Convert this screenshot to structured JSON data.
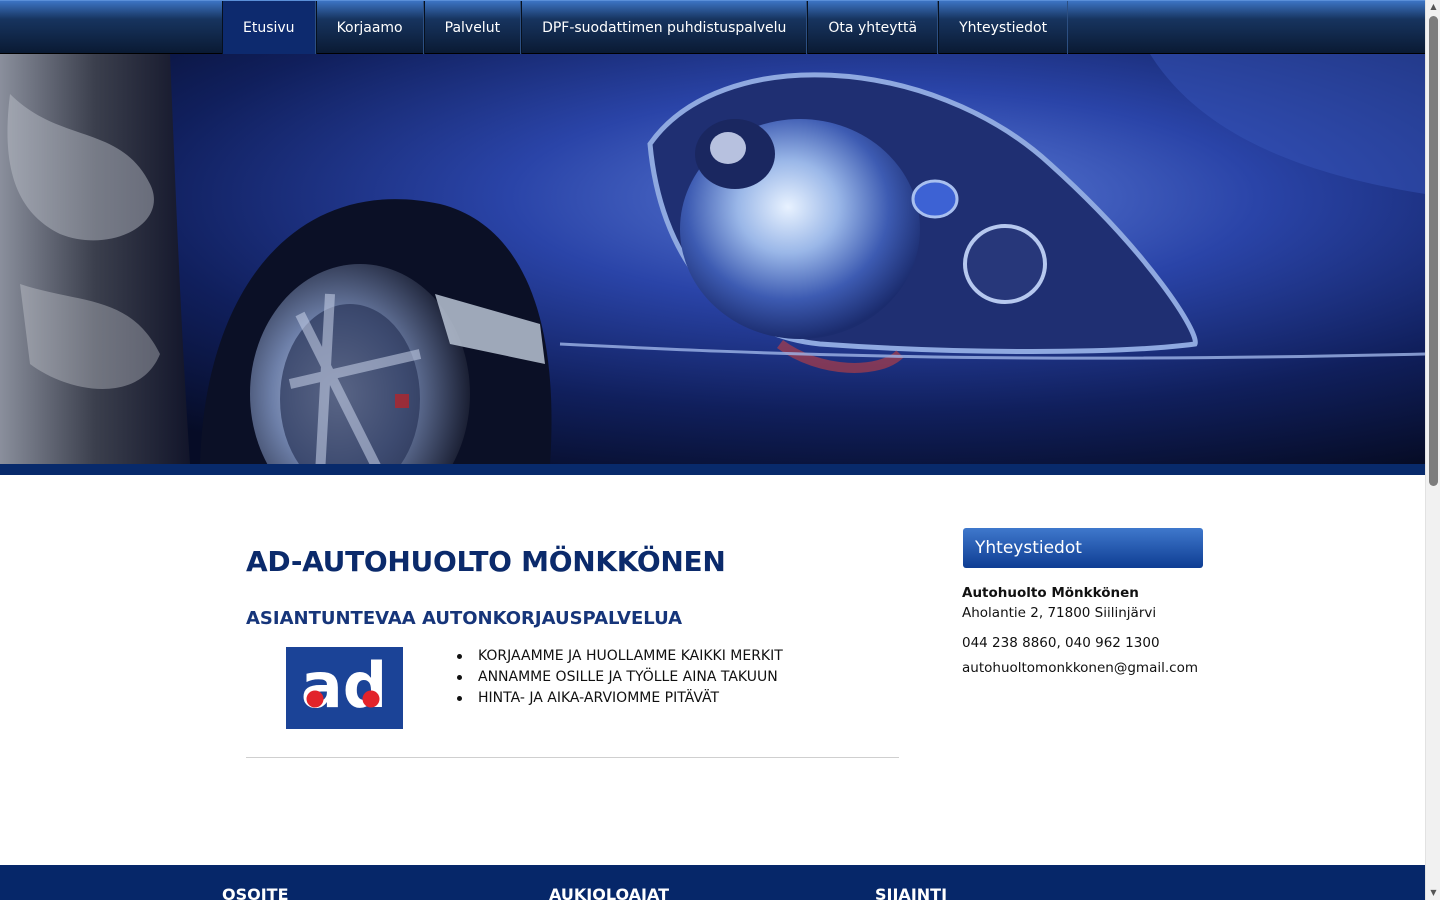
{
  "nav": {
    "items": [
      {
        "label": "Etusivu",
        "active": true
      },
      {
        "label": "Korjaamo",
        "active": false
      },
      {
        "label": "Palvelut",
        "active": false
      },
      {
        "label": "DPF-suodattimen puhdistuspalvelu",
        "active": false
      },
      {
        "label": "Ota yhteyttä",
        "active": false
      },
      {
        "label": "Yhteystiedot",
        "active": false
      }
    ]
  },
  "main": {
    "title": "AD-AUTOHUOLTO MÖNKKÖNEN",
    "subtitle": "ASIANTUNTEVAA AUTONKORJAUSPALVELUA",
    "bullets": [
      "KORJAAMME JA HUOLLAMME KAIKKI MERKIT",
      "ANNAMME OSILLE JA TYÖLLE AINA TAKUUN",
      "HINTA- JA AIKA-ARVIOMME PITÄVÄT"
    ]
  },
  "logo": {
    "text": "ad"
  },
  "sidebar": {
    "header": "Yhteystiedot",
    "company": "Autohuolto Mönkkönen",
    "address": "Aholantie 2, 71800 Siilinjärvi",
    "phone": "044 238 8860, 040 962 1300",
    "email": "autohuoltomonkkonen@gmail.com"
  },
  "footer": {
    "col1": "OSOITE",
    "col2": "AUKIOLOAJAT",
    "col3": "SIJAINTI"
  },
  "colors": {
    "nav_active": "#0d2a6e",
    "brand_dark": "#0b2a6b",
    "footer_bg": "#062769",
    "sidebar_header": "#1f56ad"
  }
}
